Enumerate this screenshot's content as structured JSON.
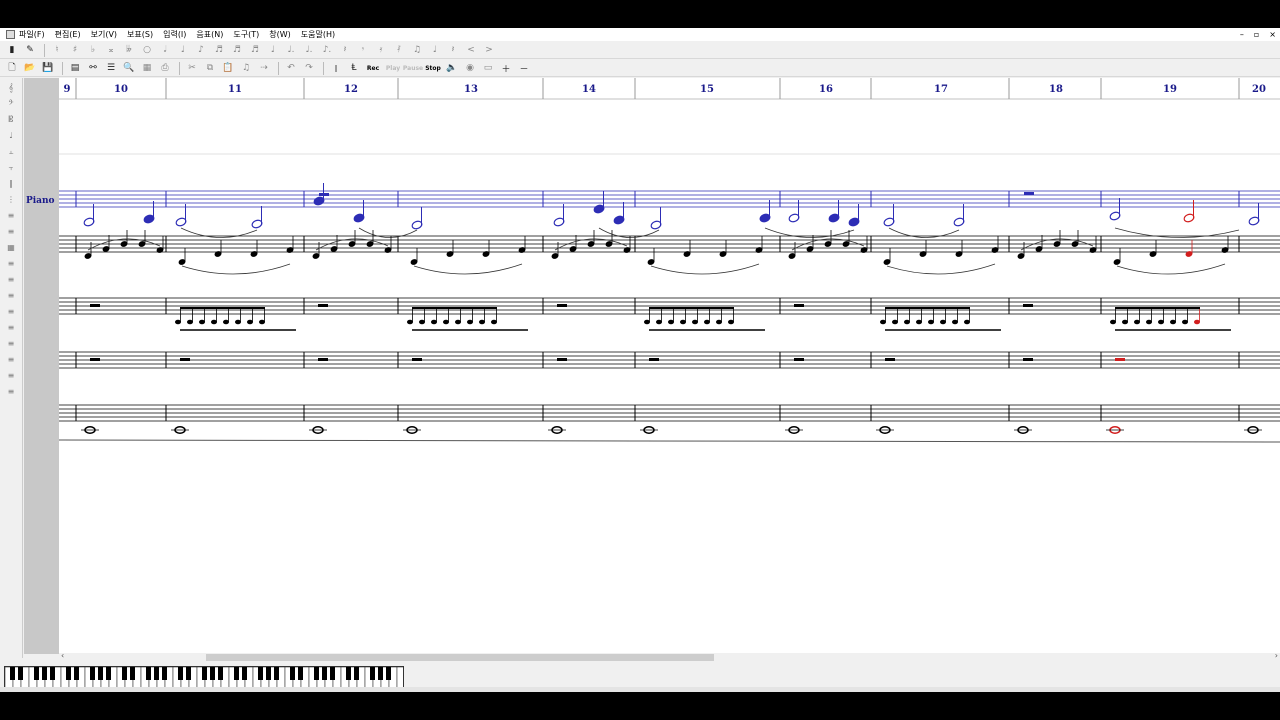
{
  "menu": {
    "items": [
      "파일(F)",
      "편집(E)",
      "보기(V)",
      "보표(S)",
      "입력(I)",
      "음표(N)",
      "도구(T)",
      "창(W)",
      "도움말(H)"
    ],
    "window_buttons": [
      "–",
      "▫",
      "×"
    ]
  },
  "toolbar1": {
    "symbols": [
      "𝄞",
      "♮",
      "♯",
      "♭",
      "𝄪",
      "𝄫",
      "○",
      "𝅗𝅥",
      "♩",
      "♪",
      "♬",
      "♬",
      "♬",
      "♩",
      "♩.",
      "♩.",
      "♪.",
      "𝄽",
      "𝄾",
      "𝄿",
      "𝅀",
      "♫",
      "♩",
      "𝄽",
      "<",
      ">"
    ]
  },
  "toolbar2": {
    "rec_label": "Rec",
    "play_label": "Play",
    "pause_label": "Pause",
    "stop_label": "Stop"
  },
  "ruler": {
    "measures": [
      "9",
      "10",
      "11",
      "12",
      "13",
      "14",
      "15",
      "16",
      "17",
      "18",
      "19",
      "20"
    ]
  },
  "staff_label": "Piano",
  "colors": {
    "blue_staff": "#2d2db5",
    "highlight_red": "#d21e1e",
    "measure_number": "#1a1a8a"
  }
}
